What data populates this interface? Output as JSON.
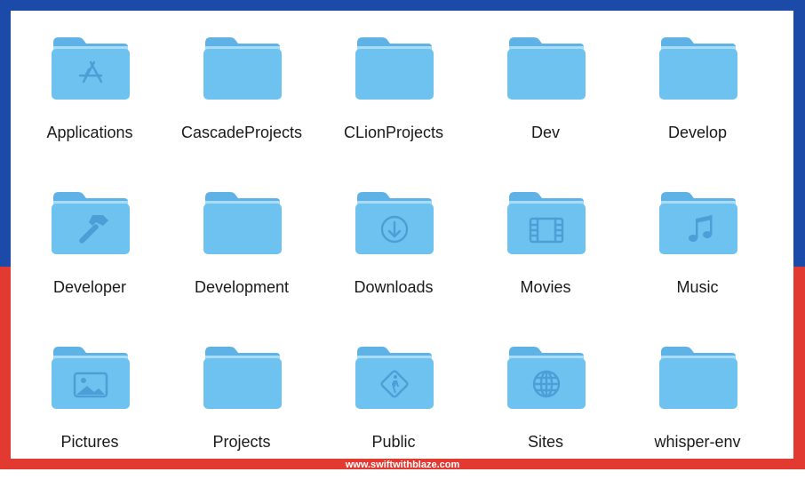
{
  "colors": {
    "top_band": "#1b4aa8",
    "bottom_band": "#e23a30",
    "folder_body": "#6ec2f0",
    "folder_back": "#5fb2e6",
    "folder_glyph": "#4a9fd6"
  },
  "folders": [
    {
      "label": "Applications",
      "icon": "app-store-icon"
    },
    {
      "label": "CascadeProjects",
      "icon": "folder-icon"
    },
    {
      "label": "CLionProjects",
      "icon": "folder-icon"
    },
    {
      "label": "Dev",
      "icon": "folder-icon"
    },
    {
      "label": "Develop",
      "icon": "folder-icon"
    },
    {
      "label": "Developer",
      "icon": "hammer-icon"
    },
    {
      "label": "Development",
      "icon": "folder-icon"
    },
    {
      "label": "Downloads",
      "icon": "download-icon"
    },
    {
      "label": "Movies",
      "icon": "film-icon"
    },
    {
      "label": "Music",
      "icon": "music-note-icon"
    },
    {
      "label": "Pictures",
      "icon": "photo-icon"
    },
    {
      "label": "Projects",
      "icon": "folder-icon"
    },
    {
      "label": "Public",
      "icon": "pedestrian-sign-icon"
    },
    {
      "label": "Sites",
      "icon": "globe-icon"
    },
    {
      "label": "whisper-env",
      "icon": "folder-icon"
    }
  ],
  "footer": {
    "watermark": "www.swiftwithblaze.com"
  }
}
